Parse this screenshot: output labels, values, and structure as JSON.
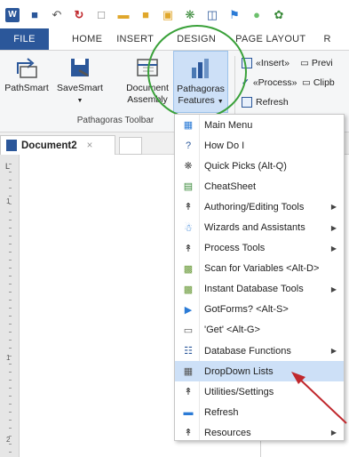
{
  "qat": {
    "icons": [
      "word-logo-icon",
      "save-icon",
      "undo-icon",
      "redo-icon",
      "new-doc-icon",
      "open-folder-icon",
      "folder-icon",
      "folder2-icon",
      "pathagoras-star-icon",
      "format-icon",
      "flag-icon",
      "circle-icon",
      "extra-icon"
    ],
    "word_logo": "W"
  },
  "tabs": [
    "FILE",
    "HOME",
    "INSERT",
    "DESIGN",
    "PAGE LAYOUT",
    "R"
  ],
  "ribbon": {
    "pathsmart": "PathSmart",
    "savesmart": "SaveSmart",
    "doc_assembly_1": "Document",
    "doc_assembly_2": "Assembly",
    "pathagoras_1": "Pathagoras",
    "pathagoras_2": "Features",
    "group_label": "Pathagoras Toolbar",
    "insert": "«Insert»",
    "process": "«Process»",
    "refresh": "Refresh",
    "preview": "Previ",
    "clipboard": "Clipb"
  },
  "document_tab": {
    "title": "Document2",
    "close": "×"
  },
  "ruler": {
    "corner": "L",
    "numbers": [
      "1",
      "1",
      "2"
    ]
  },
  "menu": {
    "items": [
      {
        "label": "Main Menu",
        "icon": "main-menu-icon",
        "submenu": false
      },
      {
        "label": "How Do I",
        "icon": "help-icon",
        "submenu": false
      },
      {
        "label": "Quick Picks (Alt-Q)",
        "icon": "quick-picks-icon",
        "submenu": false
      },
      {
        "label": "CheatSheet",
        "icon": "cheatsheet-icon",
        "submenu": false
      },
      {
        "label": "Authoring/Editing Tools",
        "icon": "authoring-tools-icon",
        "submenu": true
      },
      {
        "label": "Wizards and Assistants",
        "icon": "wizard-icon",
        "submenu": true
      },
      {
        "label": "Process Tools",
        "icon": "process-tools-icon",
        "submenu": true
      },
      {
        "label": "Scan for Variables <Alt-D>",
        "icon": "scan-icon",
        "submenu": false
      },
      {
        "label": "Instant Database Tools",
        "icon": "database-tools-icon",
        "submenu": true
      },
      {
        "label": "GotForms? <Alt-S>",
        "icon": "gotforms-icon",
        "submenu": false
      },
      {
        "label": "'Get' <Alt-G>",
        "icon": "get-icon",
        "submenu": false
      },
      {
        "label": "Database Functions",
        "icon": "database-functions-icon",
        "submenu": true
      },
      {
        "label": "DropDown Lists",
        "icon": "dropdown-lists-icon",
        "submenu": false,
        "highlighted": true
      },
      {
        "label": "Utilities/Settings",
        "icon": "utilities-icon",
        "submenu": false
      },
      {
        "label": "Refresh",
        "icon": "refresh-icon",
        "submenu": false
      },
      {
        "label": "Resources",
        "icon": "resources-icon",
        "submenu": true
      }
    ]
  },
  "colors": {
    "word_blue": "#2b579a",
    "highlight": "#cde0f7",
    "circle_green": "#3aa13a",
    "arrow_red": "#c0282d"
  }
}
